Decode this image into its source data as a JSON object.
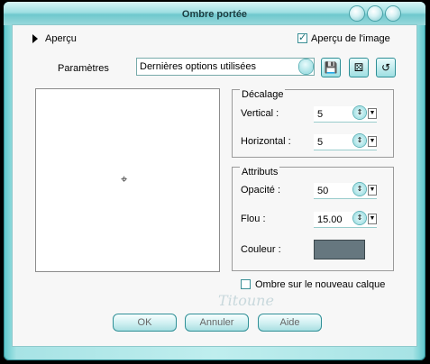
{
  "window": {
    "title": "Ombre portée"
  },
  "apercu": {
    "label": "Aperçu",
    "checkbox_label": "Aperçu de l'image",
    "checked": true
  },
  "parametres": {
    "label": "Paramètres",
    "value": "Dernières options utilisées"
  },
  "icons": [
    "save-icon",
    "dice-icon",
    "reset-icon"
  ],
  "decalage": {
    "title": "Décalage",
    "vertical_label": "Vertical :",
    "vertical_value": "5",
    "horizontal_label": "Horizontal :",
    "horizontal_value": "5"
  },
  "attributs": {
    "title": "Attributs",
    "opacite_label": "Opacité :",
    "opacite_value": "50",
    "flou_label": "Flou :",
    "flou_value": "15.00",
    "couleur_label": "Couleur :",
    "couleur_hex": "#66777f"
  },
  "new_layer": {
    "label": "Ombre sur le nouveau calque",
    "checked": false
  },
  "watermark": "Titoune",
  "buttons": {
    "ok": "OK",
    "cancel": "Annuler",
    "help": "Aide"
  }
}
